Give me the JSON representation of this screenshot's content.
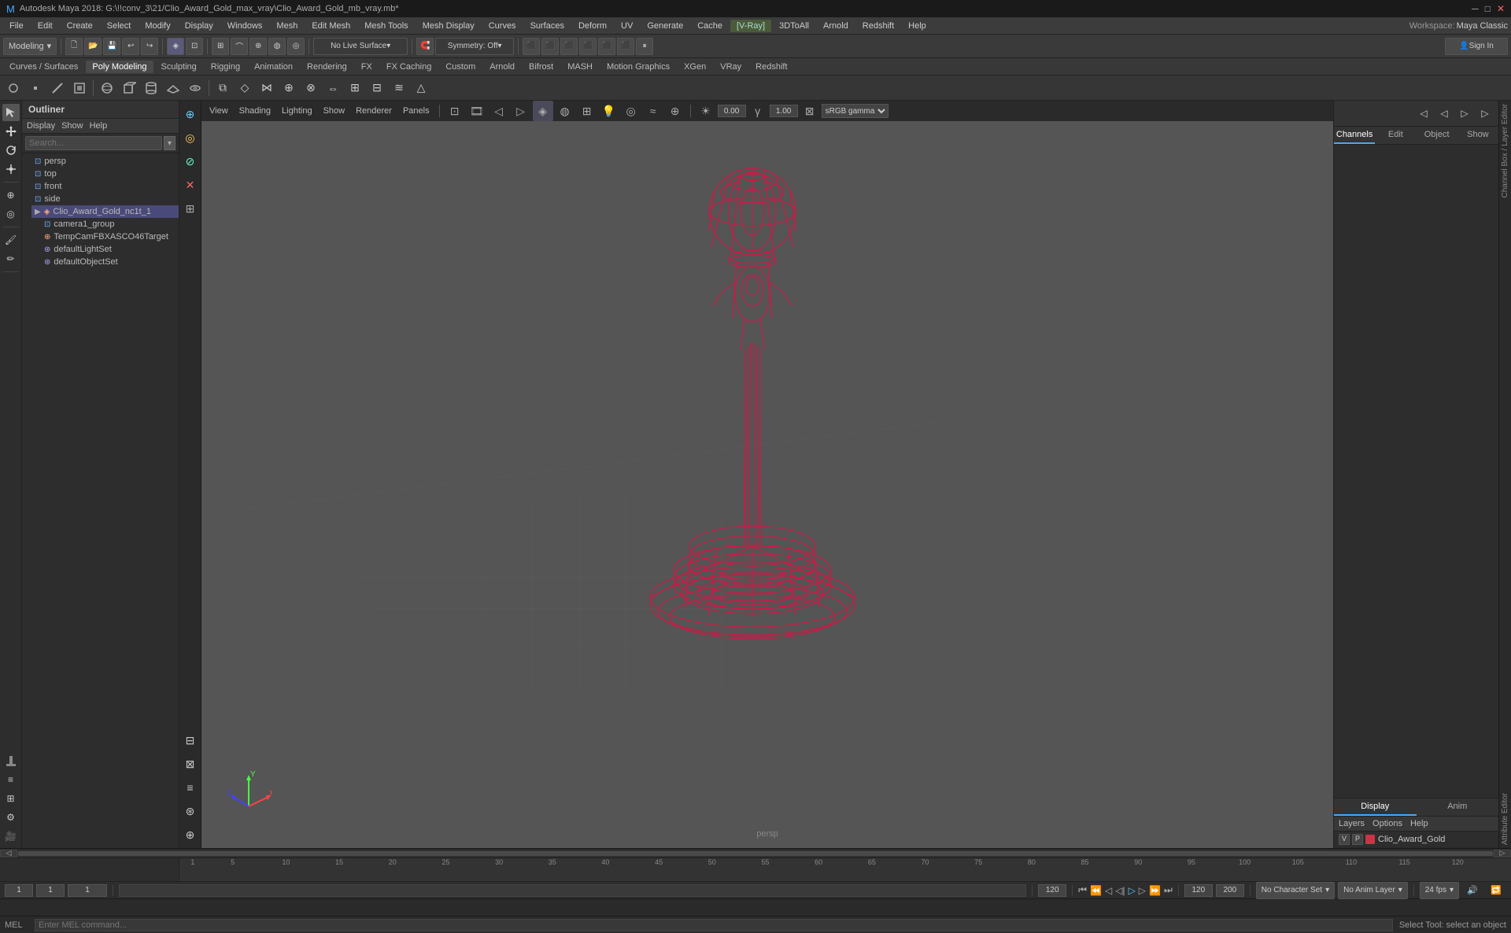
{
  "app": {
    "title": "Autodesk Maya 2018: G:\\!!conv_3\\21/Clio_Award_Gold_max_vray\\Clio_Award_Gold_mb_vray.mb*",
    "workspace_label": "Workspace:",
    "workspace_value": "Maya Classic"
  },
  "menu_bar": {
    "items": [
      "File",
      "Edit",
      "Create",
      "Select",
      "Modify",
      "Display",
      "Windows",
      "Mesh",
      "Edit Mesh",
      "Mesh Tools",
      "Mesh Display",
      "Curves",
      "Surfaces",
      "Deform",
      "UV",
      "Generate",
      "Cache",
      "V-Ray",
      "3DToAll",
      "Arnold",
      "Redshift",
      "Help"
    ]
  },
  "toolbar1": {
    "mode_label": "Modeling",
    "no_live_surface": "No Live Surface",
    "symmetry": "Symmetry: Off",
    "sign_in": "Sign In"
  },
  "toolbar2": {
    "items": [
      "Curves / Surfaces",
      "Poly Modeling",
      "Sculpting",
      "Rigging",
      "Animation",
      "Rendering",
      "FX",
      "FX Caching",
      "Custom",
      "Arnold",
      "Bifrost",
      "MASH",
      "Motion Graphics",
      "XGen",
      "VRay",
      "Redshift"
    ]
  },
  "outliner": {
    "title": "Outliner",
    "menu_items": [
      "Display",
      "Show",
      "Help"
    ],
    "search_placeholder": "Search...",
    "items": [
      {
        "label": "persp",
        "indent": 1,
        "icon": "cam"
      },
      {
        "label": "top",
        "indent": 1,
        "icon": "cam"
      },
      {
        "label": "front",
        "indent": 1,
        "icon": "cam"
      },
      {
        "label": "side",
        "indent": 1,
        "icon": "cam"
      },
      {
        "label": "Clio_Award_Gold_nc1t_1",
        "indent": 1,
        "icon": "mesh",
        "selected": true
      },
      {
        "label": "camera1_group",
        "indent": 2,
        "icon": "cam"
      },
      {
        "label": "TempCamFBXASCO46Target",
        "indent": 2,
        "icon": "aim"
      },
      {
        "label": "defaultLightSet",
        "indent": 2,
        "icon": "set"
      },
      {
        "label": "defaultObjectSet",
        "indent": 2,
        "icon": "set"
      }
    ]
  },
  "viewport": {
    "menu_items": [
      "View",
      "Shading",
      "Lighting",
      "Show",
      "Renderer",
      "Panels"
    ],
    "persp_label": "persp",
    "gamma_label": "sRGB gamma",
    "value1": "0.00",
    "value2": "1.00"
  },
  "right_panel": {
    "tabs": [
      "Channels",
      "Edit",
      "Object",
      "Show"
    ],
    "sub_tabs": [
      "Display",
      "Anim"
    ],
    "sub_menu": [
      "Layers",
      "Options",
      "Help"
    ],
    "layer": {
      "v_label": "V",
      "p_label": "P",
      "color": "#cc3344",
      "name": "Clio_Award_Gold"
    }
  },
  "transport_bar": {
    "frame_current": "1",
    "frame_start": "1",
    "frame_indicator": "1",
    "frame_end": "120",
    "frame_end2": "120",
    "max_frame": "200",
    "no_character_set": "No Character Set",
    "no_anim_layer": "No Anim Layer",
    "fps_label": "24 fps"
  },
  "mel_bar": {
    "label": "MEL",
    "status_text": "Select Tool: select an object"
  },
  "viewport_inner_toolbar": {
    "buttons": [
      "cam",
      "film",
      "prev",
      "next",
      "sel",
      "hi",
      "color",
      "grid",
      "shd1",
      "shd2",
      "shd3",
      "eye",
      "lock",
      "render"
    ]
  }
}
